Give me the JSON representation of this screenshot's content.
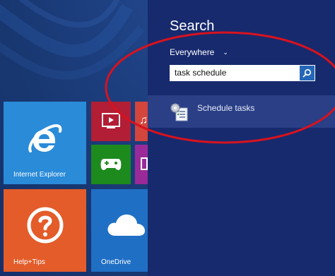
{
  "search": {
    "title": "Search",
    "scope_label": "Everywhere",
    "query": "task schedule",
    "results": [
      {
        "label": "Schedule tasks",
        "icon": "task-scheduler-icon"
      }
    ]
  },
  "tiles": {
    "internet_explorer": {
      "label": "Internet Explorer",
      "icon": "internet-explorer-icon",
      "color": "#2a8bd8"
    },
    "video": {
      "icon": "video-icon",
      "color": "#b21e35"
    },
    "games": {
      "icon": "xbox-games-icon",
      "color": "#1d8a1d"
    },
    "music": {
      "icon": "music-icon",
      "color": "#d4453c"
    },
    "purple": {
      "icon": "tile-icon",
      "color": "#9a2a9a"
    },
    "help_tips": {
      "label": "Help+Tips",
      "icon": "help-question-icon",
      "color": "#e35c29"
    },
    "onedrive": {
      "label": "OneDrive",
      "icon": "cloud-icon",
      "color": "#1f6fc4"
    }
  },
  "colors": {
    "start_background": "#1b3a78",
    "search_pane": "#172a6e",
    "selected_result": "#2a3f86",
    "annotation": "#d8121e"
  }
}
